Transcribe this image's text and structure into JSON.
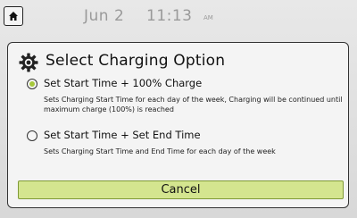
{
  "status_bar": {
    "home_icon": "home-icon",
    "date": "Jun 2",
    "time": "11:13",
    "ampm": "AM"
  },
  "dialog": {
    "icon": "gear-icon",
    "title": "Select Charging Option",
    "options": [
      {
        "label": "Set Start Time + 100% Charge",
        "description": "Sets Charging Start Time for each day of the week, Charging will be continued until maximum charge (100%) is reached",
        "selected": true
      },
      {
        "label": "Set Start Time + Set End Time",
        "description": "Sets Charging Start Time and End Time for each day of the week",
        "selected": false
      }
    ],
    "cancel_label": "Cancel"
  },
  "colors": {
    "accent": "#a6c83a",
    "button_fill": "#d4e58f",
    "status_text": "#9a9a9a"
  }
}
